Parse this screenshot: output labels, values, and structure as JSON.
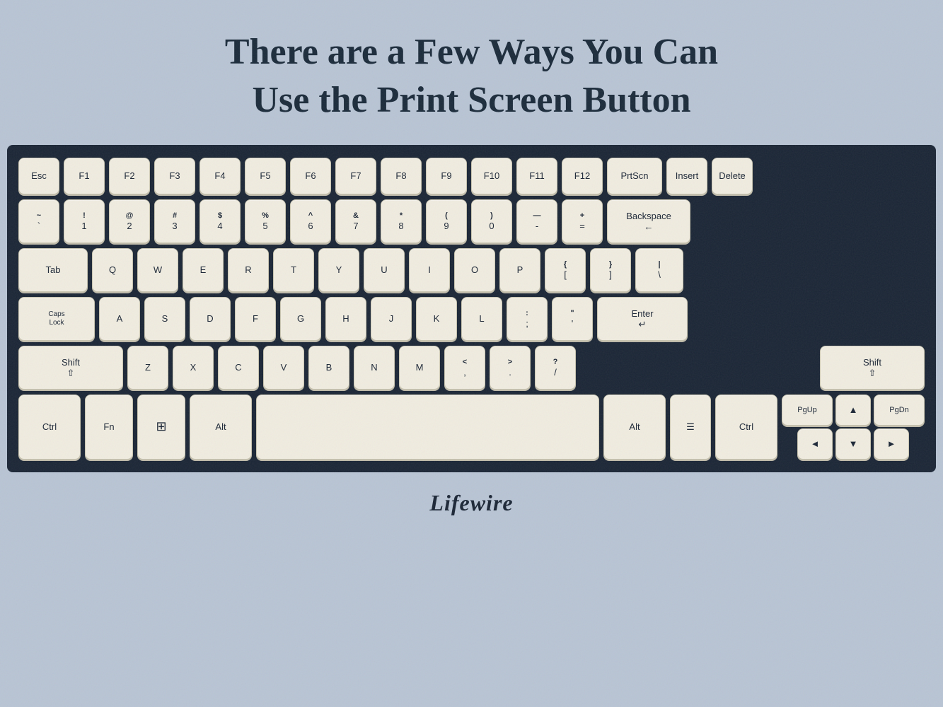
{
  "title": {
    "line1": "There are a Few Ways You Can",
    "line2": "Use the Print Screen Button"
  },
  "brand": "Lifewire",
  "keyboard": {
    "rows": [
      {
        "id": "fn-row",
        "keys": [
          {
            "label": "Esc",
            "width": "w1"
          },
          {
            "label": "F1",
            "width": "w1"
          },
          {
            "label": "F2",
            "width": "w1"
          },
          {
            "label": "F3",
            "width": "w1"
          },
          {
            "label": "F4",
            "width": "w1"
          },
          {
            "label": "F5",
            "width": "w1"
          },
          {
            "label": "F6",
            "width": "w1"
          },
          {
            "label": "F7",
            "width": "w1"
          },
          {
            "label": "F8",
            "width": "w1"
          },
          {
            "label": "F9",
            "width": "w1"
          },
          {
            "label": "F10",
            "width": "w1"
          },
          {
            "label": "F11",
            "width": "w1"
          },
          {
            "label": "F12",
            "width": "w1"
          },
          {
            "label": "PrtScn",
            "width": "w-prtscn"
          },
          {
            "label": "Insert",
            "width": "w1"
          },
          {
            "label": "Delete",
            "width": "w1"
          }
        ]
      }
    ]
  }
}
